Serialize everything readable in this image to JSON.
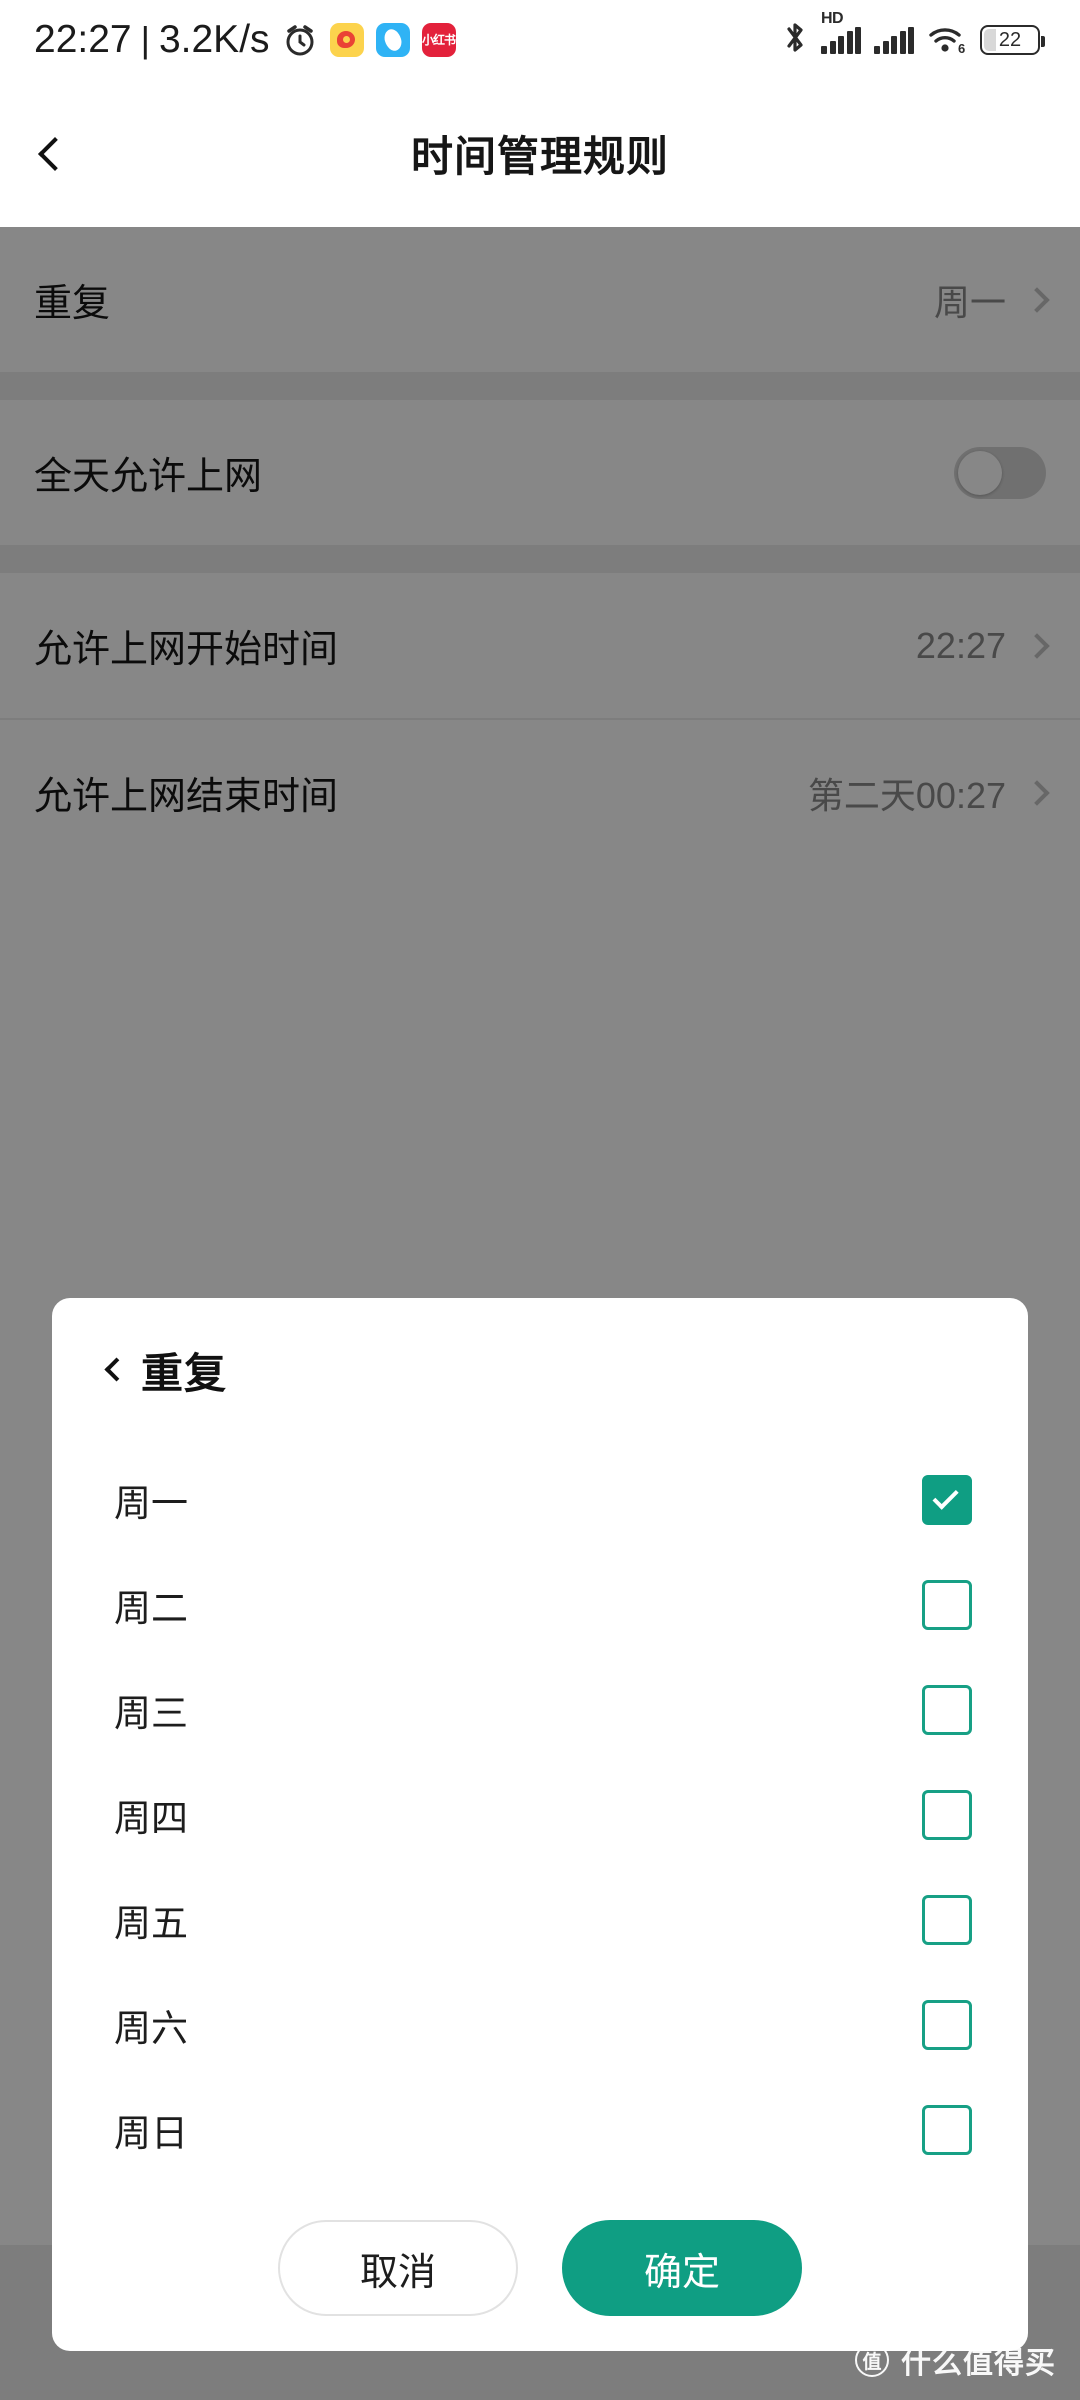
{
  "statusbar": {
    "time": "22:27",
    "separator": "|",
    "network_speed": "3.2K/s",
    "tray_icons": [
      "alarm-clock-icon",
      "weibo-icon",
      "blue-app-icon",
      "xiaohongshu-icon"
    ],
    "xhs_label": "小红书",
    "hd_label": "HD",
    "wifi_generation": "6",
    "battery_percent": "22"
  },
  "header": {
    "title": "时间管理规则",
    "back_icon": "back-chevron-icon"
  },
  "settings": {
    "rows": [
      {
        "label": "重复",
        "value": "周一",
        "type": "nav"
      },
      {
        "label": "全天允许上网",
        "value": "",
        "type": "toggle",
        "toggle_on": false
      },
      {
        "label": "允许上网开始时间",
        "value": "22:27",
        "type": "nav"
      },
      {
        "label": "允许上网结束时间",
        "value": "第二天00:27",
        "type": "nav"
      }
    ]
  },
  "dialog": {
    "title": "重复",
    "back_icon": "dialog-back-chevron-icon",
    "days": [
      {
        "label": "周一",
        "checked": true
      },
      {
        "label": "周二",
        "checked": false
      },
      {
        "label": "周三",
        "checked": false
      },
      {
        "label": "周四",
        "checked": false
      },
      {
        "label": "周五",
        "checked": false
      },
      {
        "label": "周六",
        "checked": false
      },
      {
        "label": "周日",
        "checked": false
      }
    ],
    "cancel_label": "取消",
    "confirm_label": "确定"
  },
  "watermark": {
    "badge": "值",
    "text": "什么值得买"
  },
  "colors": {
    "accent": "#0f9e83",
    "checkbox_border": "#17a085",
    "text_primary": "#161616",
    "text_secondary": "#8b8b8b",
    "scrim": "rgba(0,0,0,0.47)"
  }
}
